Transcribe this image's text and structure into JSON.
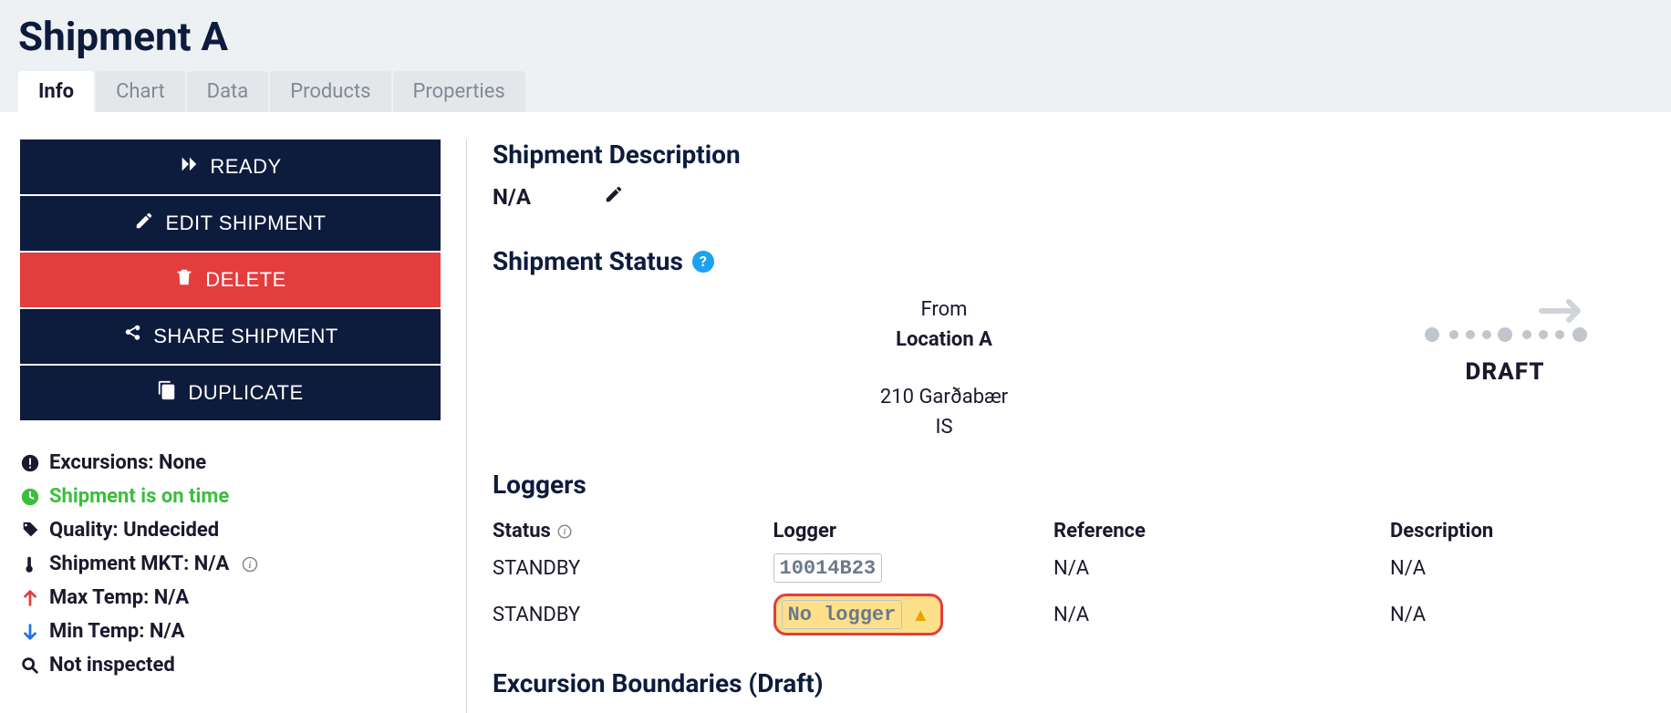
{
  "page": {
    "title": "Shipment A"
  },
  "tabs": [
    {
      "label": "Info",
      "active": true
    },
    {
      "label": "Chart",
      "active": false
    },
    {
      "label": "Data",
      "active": false
    },
    {
      "label": "Products",
      "active": false
    },
    {
      "label": "Properties",
      "active": false
    }
  ],
  "actions": {
    "ready": "READY",
    "edit": "EDIT SHIPMENT",
    "delete": "DELETE",
    "share": "SHARE SHIPMENT",
    "duplicate": "DUPLICATE"
  },
  "status_items": {
    "excursions": "Excursions: None",
    "ontime": "Shipment is on time",
    "quality": "Quality: Undecided",
    "mkt": "Shipment MKT: N/A",
    "max_temp": "Max Temp: N/A",
    "min_temp": "Min Temp: N/A",
    "inspected": "Not inspected"
  },
  "description": {
    "heading": "Shipment Description",
    "value": "N/A"
  },
  "shipment_status": {
    "heading": "Shipment Status",
    "from_label": "From",
    "from_value": "Location A",
    "addr1": "210 Garðabær",
    "addr2": "IS",
    "state": "DRAFT"
  },
  "loggers": {
    "heading": "Loggers",
    "columns": {
      "status": "Status",
      "logger": "Logger",
      "reference": "Reference",
      "description": "Description"
    },
    "rows": [
      {
        "status": "STANDBY",
        "logger": "10014B23",
        "warn": false,
        "reference": "N/A",
        "description": "N/A"
      },
      {
        "status": "STANDBY",
        "logger": "No logger",
        "warn": true,
        "reference": "N/A",
        "description": "N/A"
      }
    ]
  },
  "excursion_boundaries": {
    "heading": "Excursion Boundaries (Draft)"
  }
}
